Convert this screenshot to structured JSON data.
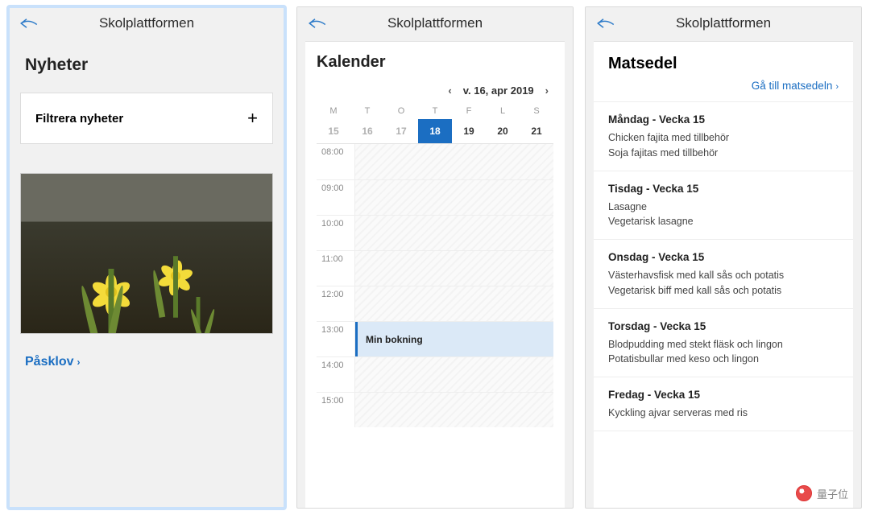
{
  "app_title": "Skolplattformen",
  "watermark": "量子位",
  "news": {
    "heading": "Nyheter",
    "filter_label": "Filtrera nyheter",
    "story_link": "Påsklov"
  },
  "calendar": {
    "heading": "Kalender",
    "week_label": "v. 16, apr 2019",
    "dow": [
      "M",
      "T",
      "O",
      "T",
      "F",
      "L",
      "S"
    ],
    "dates": [
      {
        "d": "15",
        "in": false
      },
      {
        "d": "16",
        "in": false
      },
      {
        "d": "17",
        "in": false
      },
      {
        "d": "18",
        "in": true,
        "today": true
      },
      {
        "d": "19",
        "in": true
      },
      {
        "d": "20",
        "in": true
      },
      {
        "d": "21",
        "in": true
      }
    ],
    "hours": [
      "08:00",
      "09:00",
      "10:00",
      "11:00",
      "12:00",
      "13:00",
      "14:00",
      "15:00"
    ],
    "booking_hour": "13:00",
    "booking_label": "Min bokning"
  },
  "menu": {
    "heading": "Matsedel",
    "link": "Gå till matsedeln",
    "days": [
      {
        "title": "Måndag - Vecka 15",
        "meals": [
          "Chicken fajita med tillbehör",
          "Soja fajitas med tillbehör"
        ]
      },
      {
        "title": "Tisdag - Vecka 15",
        "meals": [
          "Lasagne",
          "Vegetarisk lasagne"
        ]
      },
      {
        "title": "Onsdag - Vecka 15",
        "meals": [
          "Västerhavsfisk med kall sås och potatis",
          "Vegetarisk biff med kall sås och potatis"
        ]
      },
      {
        "title": "Torsdag - Vecka 15",
        "meals": [
          "Blodpudding med stekt fläsk och lingon",
          "Potatisbullar med keso och lingon"
        ]
      },
      {
        "title": "Fredag - Vecka 15",
        "meals": [
          "Kyckling ajvar serveras med ris"
        ]
      }
    ]
  }
}
